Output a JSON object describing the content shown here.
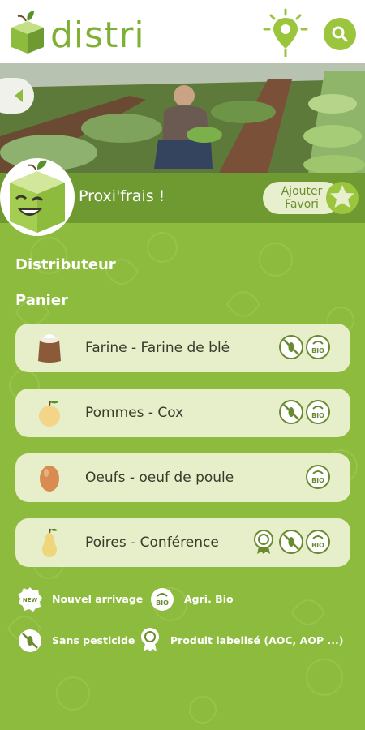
{
  "app": {
    "logo_text": "distri"
  },
  "header": {
    "map_icon": "map-pin-sun-icon",
    "search_icon": "search-icon"
  },
  "shop": {
    "name": "Proxi'frais !",
    "favorite_line1": "Ajouter",
    "favorite_line2": "Favori"
  },
  "sections": {
    "distributor": "Distributeur",
    "basket": "Panier"
  },
  "products": [
    {
      "name": "Farine - Farine de blé",
      "icon": "flour-sack-icon",
      "badges": [
        "no-pesticide-icon",
        "bio-icon"
      ]
    },
    {
      "name": "Pommes - Cox",
      "icon": "apple-icon",
      "badges": [
        "no-pesticide-icon",
        "bio-icon"
      ]
    },
    {
      "name": "Oeufs - oeuf de poule",
      "icon": "egg-icon",
      "badges": [
        "bio-icon"
      ]
    },
    {
      "name": "Poires - Conférence",
      "icon": "pear-icon",
      "badges": [
        "label-icon",
        "no-pesticide-icon",
        "bio-icon"
      ]
    }
  ],
  "legend": {
    "new": "Nouvel arrivage",
    "bio": "Agri. Bio",
    "no_pesticide": "Sans pesticide",
    "label": "Produit labelisé (AOC, AOP ...)",
    "new_badge_text": "NEW",
    "bio_badge_text": "BIO"
  },
  "colors": {
    "brand_green": "#7fb035",
    "background": "#8dbb3e",
    "band": "#6f9a31",
    "card": "#e6efc9"
  }
}
